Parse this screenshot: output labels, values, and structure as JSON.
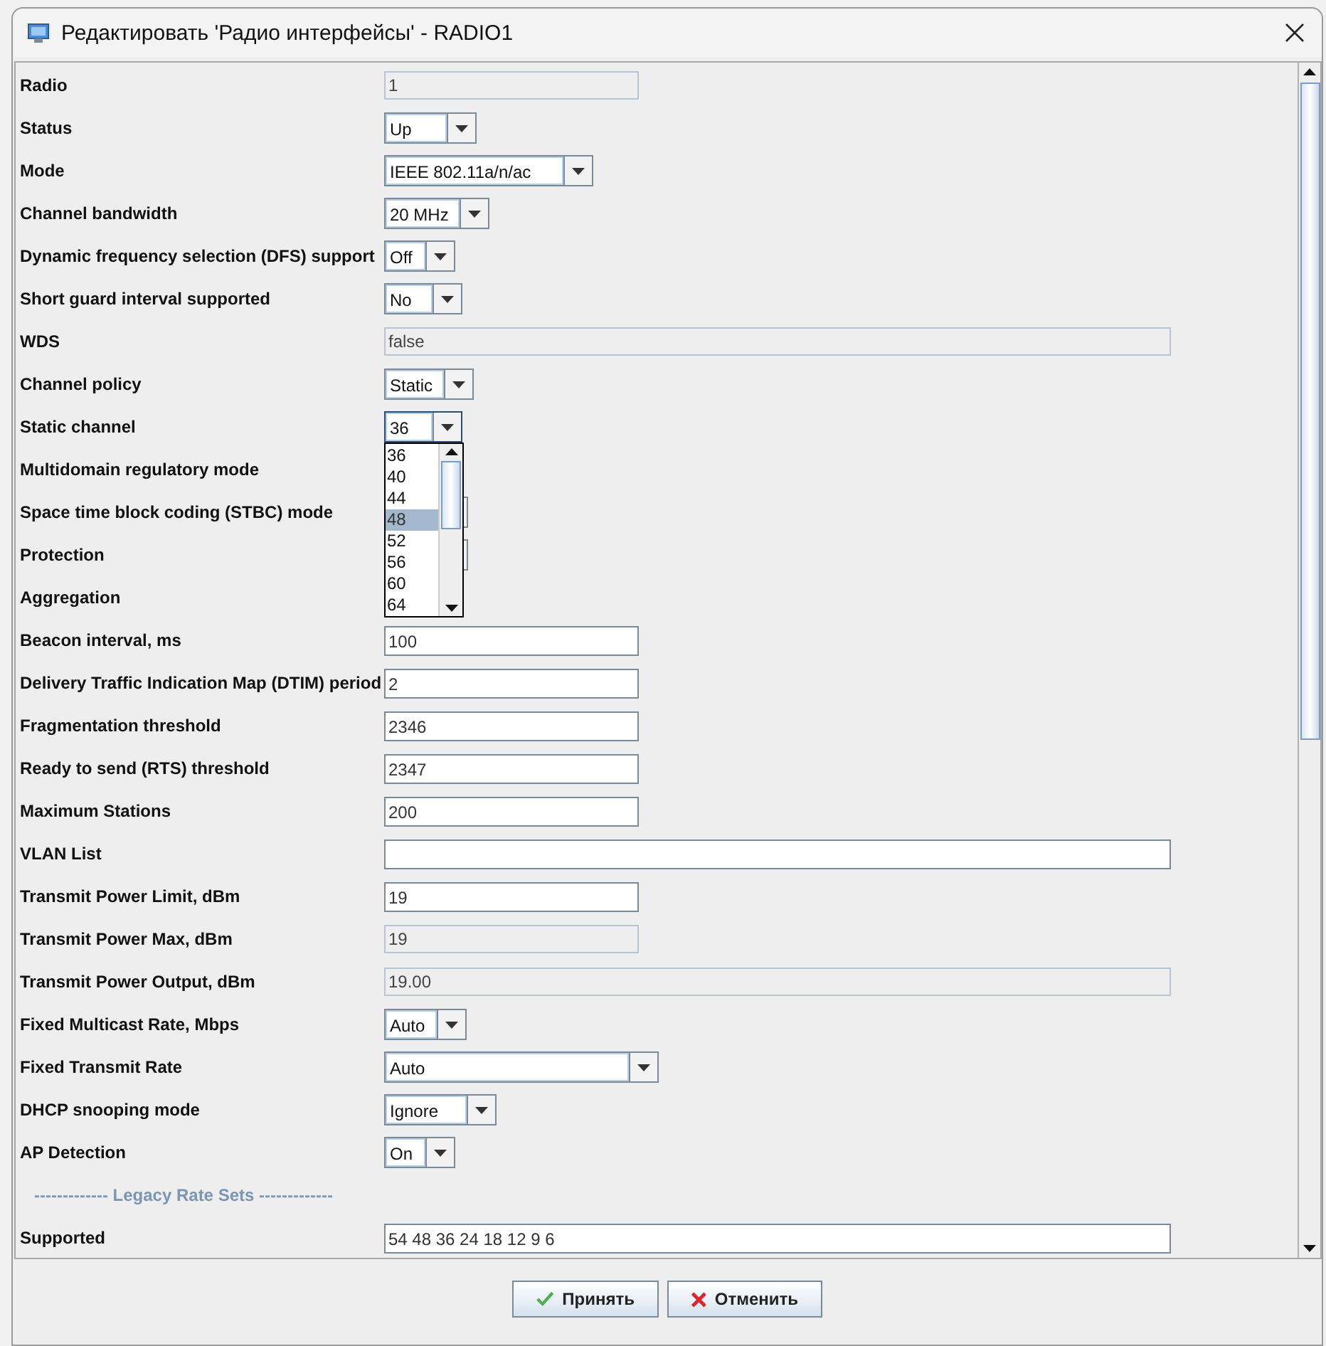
{
  "window": {
    "title": "Редактировать 'Радио интерфейсы' - RADIO1"
  },
  "fields": [
    {
      "label": "Radio",
      "kind": "readonly",
      "value": "1"
    },
    {
      "label": "Status",
      "kind": "select",
      "value": "Up"
    },
    {
      "label": "Mode",
      "kind": "select",
      "value": "IEEE 802.11a/n/ac"
    },
    {
      "label": "Channel bandwidth",
      "kind": "select",
      "value": "20 MHz"
    },
    {
      "label": "Dynamic frequency selection (DFS) support",
      "kind": "select",
      "value": "Off"
    },
    {
      "label": "Short guard interval supported",
      "kind": "select",
      "value": "No"
    },
    {
      "label": "WDS",
      "kind": "readonly",
      "value": "false"
    },
    {
      "label": "Channel policy",
      "kind": "select",
      "value": "Static"
    },
    {
      "label": "Static channel",
      "kind": "select",
      "value": "36",
      "dropdown": {
        "expanded": true,
        "options": [
          {
            "label": "36",
            "selected": false
          },
          {
            "label": "40",
            "selected": false
          },
          {
            "label": "44",
            "selected": false
          },
          {
            "label": "48",
            "selected": true
          },
          {
            "label": "52",
            "selected": false
          },
          {
            "label": "56",
            "selected": false
          },
          {
            "label": "60",
            "selected": false
          },
          {
            "label": "64",
            "selected": false
          }
        ]
      }
    },
    {
      "label": "Multidomain regulatory mode",
      "kind": "none"
    },
    {
      "label": "Space time block coding (STBC) mode",
      "kind": "select"
    },
    {
      "label": "Protection",
      "kind": "select"
    },
    {
      "label": "Aggregation",
      "kind": "none"
    },
    {
      "label": "Beacon interval, ms",
      "kind": "input",
      "value": "100"
    },
    {
      "label": "Delivery Traffic Indication Map (DTIM) period",
      "kind": "input",
      "value": "2"
    },
    {
      "label": "Fragmentation threshold",
      "kind": "input",
      "value": "2346"
    },
    {
      "label": "Ready to send (RTS) threshold",
      "kind": "input",
      "value": "2347"
    },
    {
      "label": "Maximum Stations",
      "kind": "input",
      "value": "200"
    },
    {
      "label": "VLAN List",
      "kind": "input"
    },
    {
      "label": "Transmit Power Limit, dBm",
      "kind": "input",
      "value": "19"
    },
    {
      "label": "Transmit Power Max, dBm",
      "kind": "readonly",
      "value": "19"
    },
    {
      "label": "Transmit Power Output, dBm",
      "kind": "readonly",
      "value": "19.00"
    },
    {
      "label": "Fixed Multicast Rate, Mbps",
      "kind": "select",
      "value": "Auto"
    },
    {
      "label": "Fixed Transmit Rate",
      "kind": "select",
      "value": "Auto"
    },
    {
      "label": "DHCP snooping mode",
      "kind": "select",
      "value": "Ignore"
    },
    {
      "label": "AP Detection",
      "kind": "select",
      "value": "On"
    },
    {
      "label": "------------- Legacy Rate Sets -------------",
      "kind": "section"
    },
    {
      "label": "Supported",
      "kind": "input",
      "value": "54 48 36 24 18 12 9 6"
    }
  ],
  "buttons": [
    {
      "label": "Принять",
      "kind": "ok"
    },
    {
      "label": "Отменить",
      "kind": "cancel"
    }
  ]
}
